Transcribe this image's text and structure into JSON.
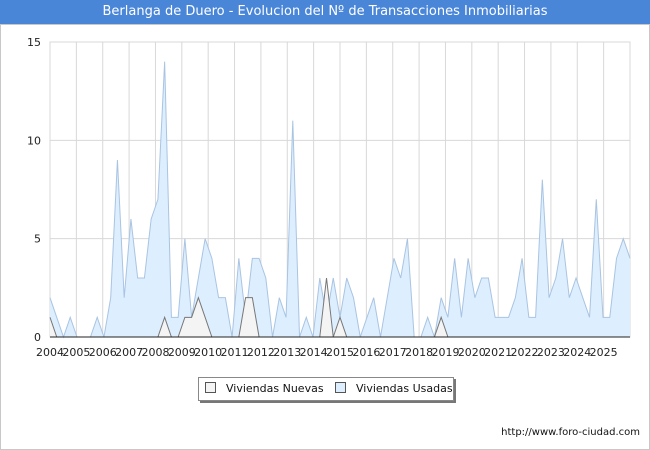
{
  "header": {
    "title": "Berlanga de Duero - Evolucion del Nº de Transacciones Inmobiliarias"
  },
  "footer": {
    "url": "http://www.foro-ciudad.com"
  },
  "colors": {
    "title_bar": "#4a86d8",
    "usadas_fill": "#ddeeff",
    "usadas_line": "#a9c4e2",
    "nuevas_fill": "#f4f4f4",
    "nuevas_line": "#777777",
    "grid": "#d8d8d8"
  },
  "chart_data": {
    "type": "area",
    "title": "Berlanga de Duero - Evolucion del Nº de Transacciones Inmobiliarias",
    "xlabel": "",
    "ylabel": "",
    "ylim": [
      0,
      15
    ],
    "yticks": [
      0,
      5,
      10,
      15
    ],
    "x_tick_labels": [
      "2004",
      "2005",
      "2006",
      "2007",
      "2008",
      "2009",
      "2010",
      "2011",
      "2012",
      "2013",
      "2014",
      "2015",
      "2016",
      "2017",
      "2018",
      "2019",
      "2020",
      "2021",
      "2022",
      "2023",
      "2024",
      "2025"
    ],
    "x_start_year": 2004,
    "points_per_year": 4,
    "grid": true,
    "legend_position": "bottom-center",
    "series": [
      {
        "name": "Viviendas Usadas",
        "values": [
          2,
          1,
          0,
          1,
          0,
          0,
          0,
          1,
          0,
          2,
          9,
          2,
          6,
          3,
          3,
          6,
          7,
          14,
          1,
          1,
          5,
          1,
          3,
          5,
          4,
          2,
          2,
          0,
          4,
          1,
          4,
          4,
          3,
          0,
          2,
          1,
          11,
          0,
          1,
          0,
          3,
          1,
          3,
          1,
          3,
          2,
          0,
          1,
          2,
          0,
          2,
          4,
          3,
          5,
          0,
          0,
          1,
          0,
          2,
          1,
          4,
          1,
          4,
          2,
          3,
          3,
          1,
          1,
          1,
          2,
          4,
          1,
          1,
          8,
          2,
          3,
          5,
          2,
          3,
          2,
          1,
          7,
          1,
          1,
          4,
          5,
          4
        ]
      },
      {
        "name": "Viviendas Nuevas",
        "values": [
          1,
          0,
          0,
          0,
          0,
          0,
          0,
          0,
          0,
          0,
          0,
          0,
          0,
          0,
          0,
          0,
          0,
          1,
          0,
          0,
          1,
          1,
          2,
          1,
          0,
          0,
          0,
          0,
          0,
          2,
          2,
          0,
          0,
          0,
          0,
          0,
          0,
          0,
          0,
          0,
          0,
          3,
          0,
          1,
          0,
          0,
          0,
          0,
          0,
          0,
          0,
          0,
          0,
          0,
          0,
          0,
          0,
          0,
          1,
          0,
          0,
          0,
          0,
          0,
          0,
          0,
          0,
          0,
          0,
          0,
          0,
          0,
          0,
          0,
          0,
          0,
          0,
          0,
          0,
          0,
          0,
          0,
          0,
          0,
          0,
          0,
          0
        ]
      }
    ]
  }
}
